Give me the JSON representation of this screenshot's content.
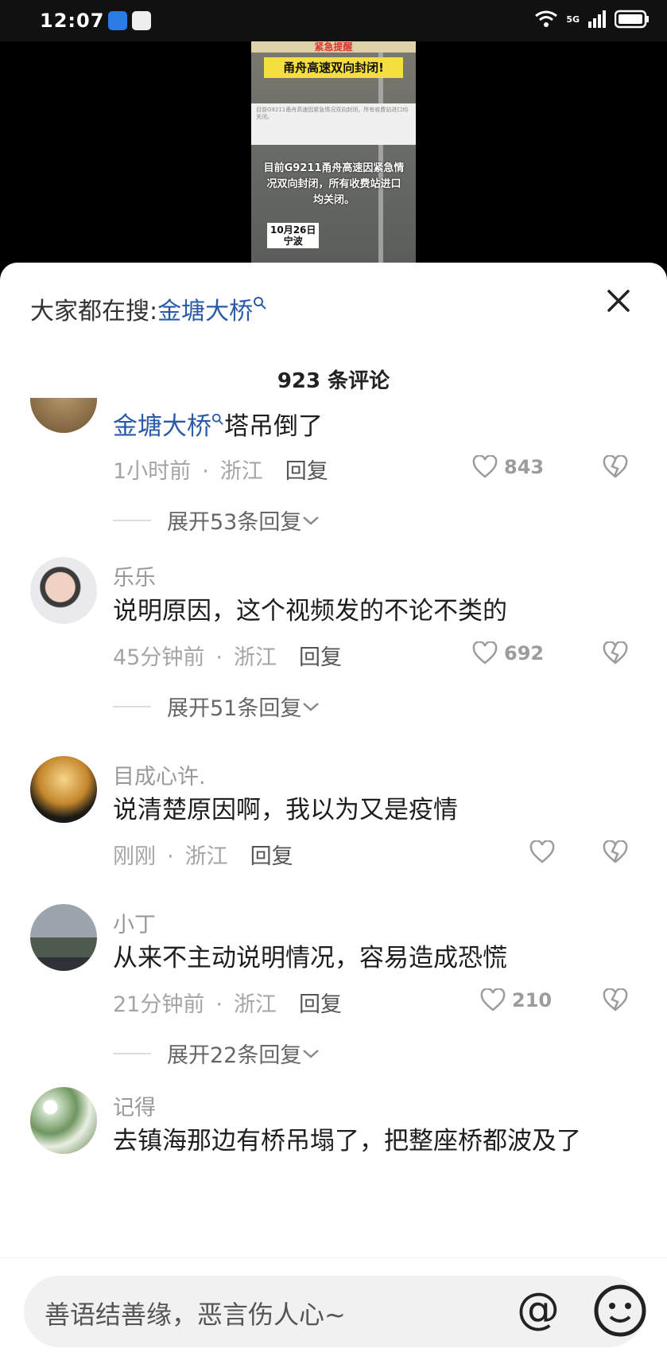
{
  "status_bar": {
    "time": "12:07",
    "network": "5G"
  },
  "video": {
    "banner_top": "紧急提醒",
    "banner_title": "甬舟高速双向封闭!",
    "card_text": "目前G9211甬舟高速因紧急情况双向封闭，所有收费站进口均关闭。",
    "message": "目前G9211甬舟高速因紧急情况双向封闭，所有收费站进口均关闭。",
    "date": "10月26日",
    "location": "宁波"
  },
  "panel": {
    "search_prefix": "大家都在搜:",
    "search_keyword": "金塘大桥",
    "comment_count": "923 条评论"
  },
  "comments": [
    {
      "text_link": "金塘大桥",
      "text": "塔吊倒了",
      "time": "1小时前",
      "region": "浙江",
      "reply": "回复",
      "likes": "843",
      "expand": "展开53条回复"
    },
    {
      "name": "乐乐",
      "text": "说明原因，这个视频发的不论不类的",
      "time": "45分钟前",
      "region": "浙江",
      "reply": "回复",
      "likes": "692",
      "expand": "展开51条回复"
    },
    {
      "name": "目成心许.",
      "text": "说清楚原因啊，我以为又是疫情",
      "time": "刚刚",
      "region": "浙江",
      "reply": "回复",
      "likes": ""
    },
    {
      "name": "小丁",
      "text": "从来不主动说明情况，容易造成恐慌",
      "time": "21分钟前",
      "region": "浙江",
      "reply": "回复",
      "likes": "210",
      "expand": "展开22条回复"
    },
    {
      "name": "记得",
      "text": "去镇海那边有桥吊塌了，把整座桥都波及了"
    }
  ],
  "input": {
    "placeholder": "善语结善缘，恶言伤人心~"
  },
  "colors": {
    "link": "#2b5aa6",
    "meta": "#a5a5a5"
  }
}
